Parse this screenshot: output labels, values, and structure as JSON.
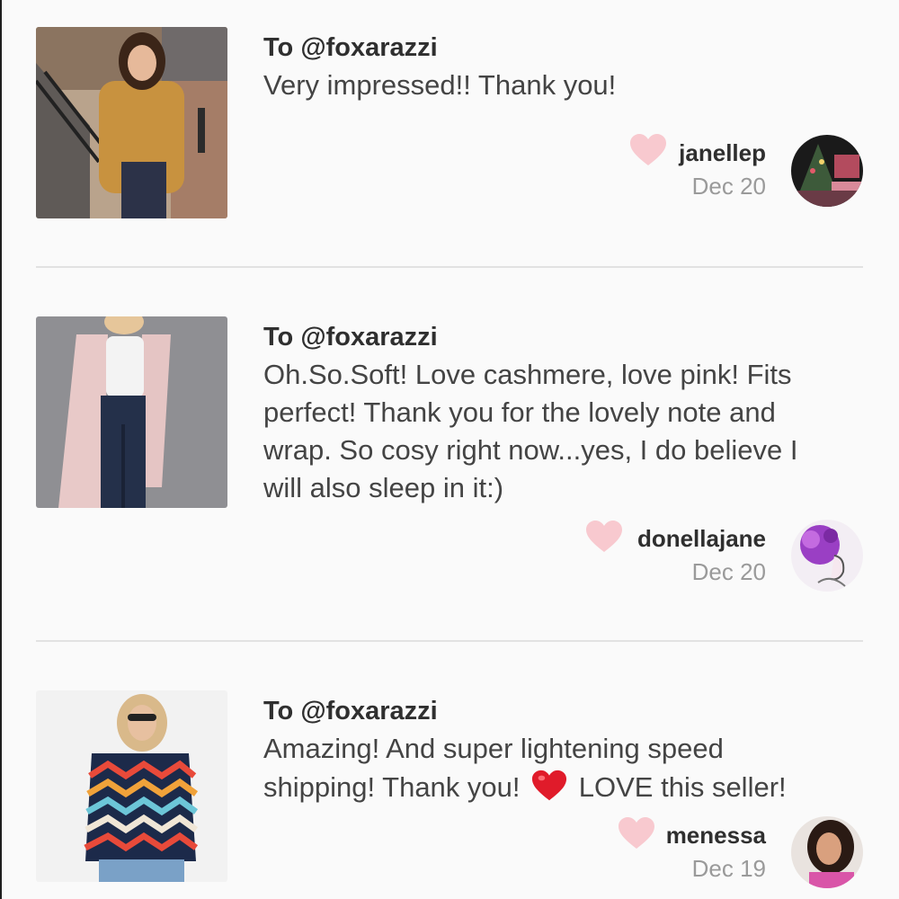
{
  "colors": {
    "background": "#fafafa",
    "like_heart": "#f8c9cf",
    "divider": "#e2e2e2",
    "date_text": "#9a9a9a"
  },
  "reviews": [
    {
      "recipient": "To @foxarazzi",
      "message": "Very impressed!! Thank you!",
      "username": "janellep",
      "date": "Dec 20",
      "thumbnail": "woman in mustard sweater on city street",
      "avatar": "christmas tree interior"
    },
    {
      "recipient": "To @foxarazzi",
      "message": "Oh.So.Soft! Love cashmere, love pink! Fits perfect! Thank you for the lovely note and wrap. So cosy right now...yes, I do believe I will also sleep in it:)",
      "username": "donellajane",
      "date": "Dec 20",
      "thumbnail": "woman in pink cardigan and jeans",
      "avatar": "purple watercolor portrait"
    },
    {
      "recipient": "To @foxarazzi",
      "message_part1": "Amazing! And super lightening speed shipping! Thank you!",
      "message_part2": "LOVE this seller!",
      "emoji": "red-heart-emoji",
      "username": "menessa",
      "date": "Dec 19",
      "thumbnail": "woman in chevron sweater and sunglasses",
      "avatar": "smiling woman selfie"
    }
  ],
  "icons": {
    "like": "heart-icon"
  }
}
